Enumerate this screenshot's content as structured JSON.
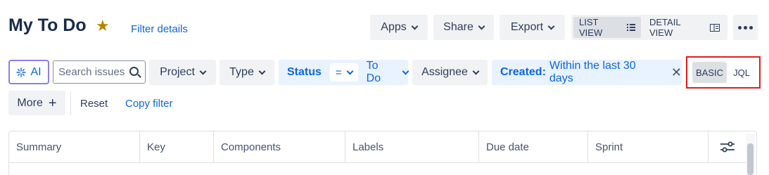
{
  "header": {
    "title": "My To Do",
    "filter_details": "Filter details",
    "apps": "Apps",
    "share": "Share",
    "export": "Export",
    "list_view": "LIST VIEW",
    "detail_view": "DETAIL VIEW"
  },
  "filters": {
    "ai": "AI",
    "search_placeholder": "Search issues",
    "project": "Project",
    "type": "Type",
    "status_label": "Status",
    "status_operator": "=",
    "status_value": "To Do",
    "assignee": "Assignee",
    "created_label": "Created:",
    "created_value": "Within the last 30 days",
    "basic": "BASIC",
    "jql": "JQL",
    "more": "More",
    "reset": "Reset",
    "copy_filter": "Copy filter"
  },
  "table": {
    "columns": [
      "Summary",
      "Key",
      "Components",
      "Labels",
      "Due date",
      "Sprint"
    ]
  },
  "colors": {
    "accent": "#0c66e4",
    "star": "#b38600",
    "highlight_box": "#e01e1e"
  }
}
